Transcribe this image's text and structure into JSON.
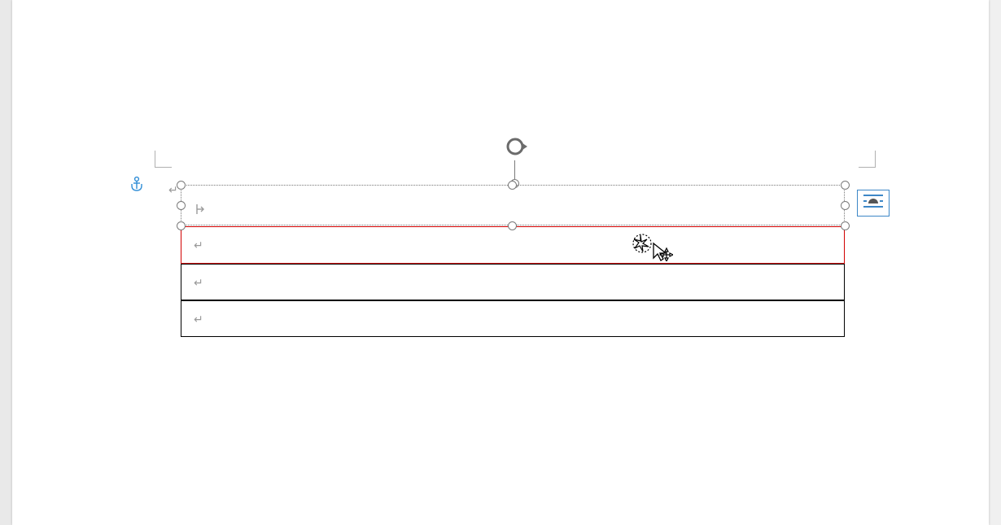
{
  "glyphs": {
    "para": "↵",
    "indent": "⇤"
  },
  "colors": {
    "highlight_border": "#d20000",
    "anchor": "#2f8dd6",
    "layout_button_border": "#3d87c7"
  },
  "textbox": {
    "rows": 2
  },
  "table": {
    "rows": [
      {
        "highlight": true
      },
      {
        "highlight": false
      },
      {
        "highlight": false
      }
    ]
  }
}
